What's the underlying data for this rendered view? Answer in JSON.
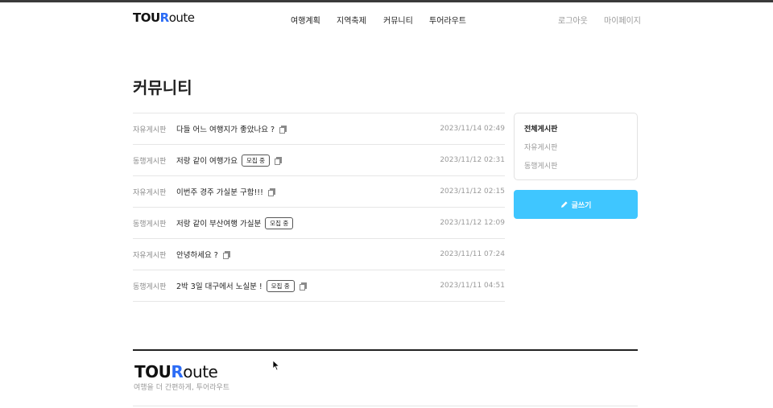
{
  "header": {
    "logo": {
      "part1": "TOU",
      "part2": "R",
      "part3": "oute"
    },
    "nav": [
      {
        "label": "여행계획"
      },
      {
        "label": "지역축제"
      },
      {
        "label": "커뮤니티"
      },
      {
        "label": "투어라우트"
      }
    ],
    "util": [
      {
        "label": "로그아웃"
      },
      {
        "label": "마이페이지"
      }
    ]
  },
  "page": {
    "title": "커뮤니티"
  },
  "posts": [
    {
      "category": "자유게시판",
      "title": "다들 어느 여행지가 좋았나요 ?",
      "badge": "",
      "date": "2023/11/14 02:49"
    },
    {
      "category": "동행게시판",
      "title": "저랑 같이 여행가요",
      "badge": "모집 중",
      "date": "2023/11/12 02:31"
    },
    {
      "category": "자유게시판",
      "title": "이번주 경주 가실분 구함!!!",
      "badge": "",
      "date": "2023/11/12 02:15"
    },
    {
      "category": "동행게시판",
      "title": "저랑 같이 부산여행 가실분",
      "badge": "모집 중",
      "date": "2023/11/12 12:09"
    },
    {
      "category": "자유게시판",
      "title": "안녕하세요 ?",
      "badge": "",
      "date": "2023/11/11 07:24"
    },
    {
      "category": "동행게시판",
      "title": "2박 3일 대구에서 노실분 !",
      "badge": "모집 중",
      "date": "2023/11/11 04:51"
    }
  ],
  "sidebar": {
    "items": [
      {
        "label": "전체게시판"
      },
      {
        "label": "자유게시판"
      },
      {
        "label": "동행게시판"
      }
    ],
    "write_button": "글쓰기"
  },
  "footer": {
    "logo": {
      "part1": "TOU",
      "part2": "R",
      "part3": "oute"
    },
    "tagline": "여행을 더 간편하게, 투어라우트"
  },
  "colors": {
    "accent": "#3fc6ff",
    "logo_r": "#2c6cf5"
  },
  "icons": {
    "post": "document-icon",
    "write": "pencil-icon"
  }
}
